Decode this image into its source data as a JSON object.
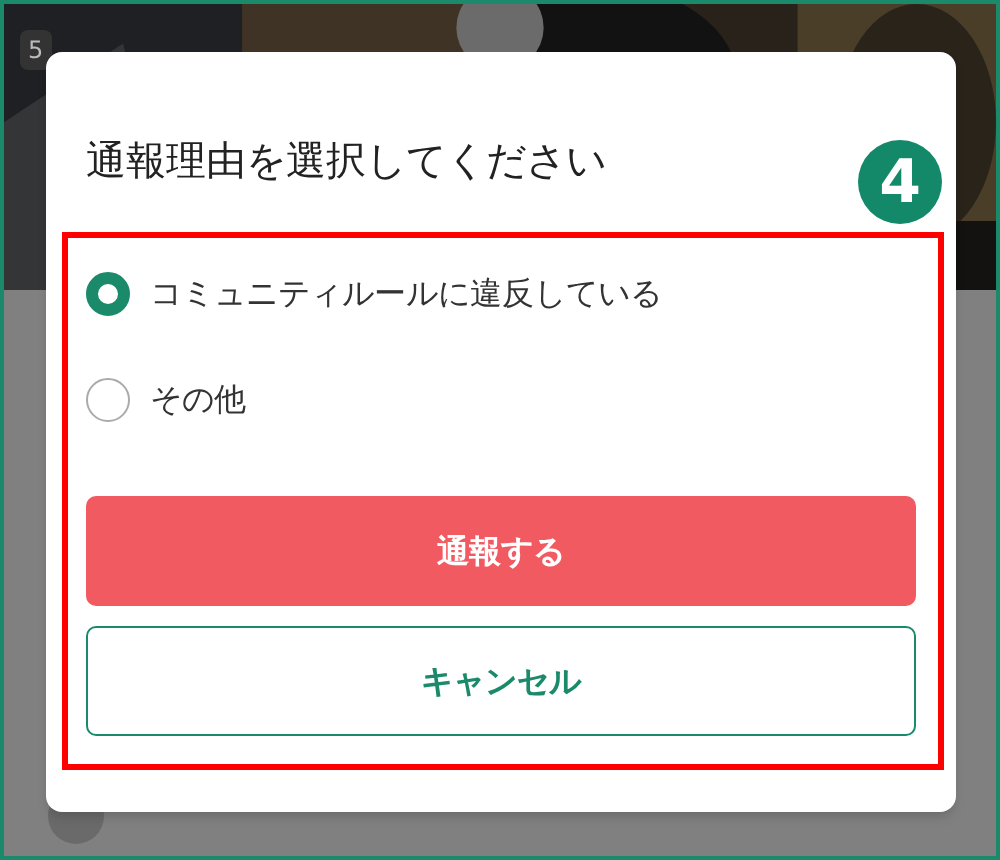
{
  "background": {
    "badge": "5"
  },
  "dialog": {
    "title": "通報理由を選択してください",
    "options": [
      {
        "label": "コミュニティルールに違反している",
        "selected": true
      },
      {
        "label": "その他",
        "selected": false
      }
    ],
    "buttons": [
      {
        "label": "通報する",
        "kind": "primary"
      },
      {
        "label": "キャンセル",
        "kind": "outline"
      }
    ]
  },
  "annotation": {
    "step": "4"
  }
}
